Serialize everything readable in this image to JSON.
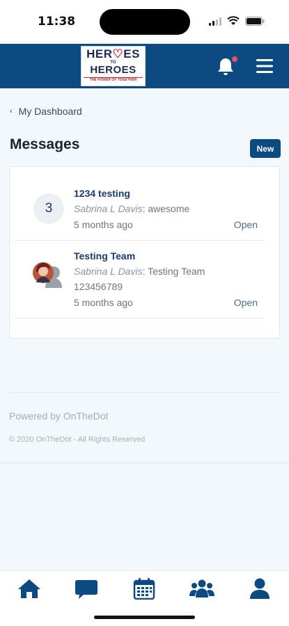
{
  "status_bar": {
    "time": "11:38"
  },
  "header": {
    "logo": {
      "line1": "HER",
      "line1_heart": "♡",
      "line1_end": "ES",
      "line2": "TO",
      "line3": "HEROES",
      "tagline": "THE POWER OF TOGETHER"
    }
  },
  "breadcrumb": {
    "chevron": "‹",
    "label": "My Dashboard"
  },
  "page": {
    "title": "Messages",
    "new_button": "New"
  },
  "threads": [
    {
      "badge": "3",
      "title": "1234 testing",
      "sender": "Sabrina L Davis",
      "preview": ": awesome",
      "extra": "",
      "time": "5 months ago",
      "action": "Open"
    },
    {
      "badge": "",
      "title": "Testing Team",
      "sender": "Sabrina L Davis",
      "preview": ": Testing Team",
      "extra": "123456789",
      "time": "5 months ago",
      "action": "Open"
    }
  ],
  "footer": {
    "powered": "Powered by OnTheDot",
    "copyright": "© 2020 OnTheDot - All Rights Reserved"
  },
  "tabbar": {
    "items": [
      "home-icon",
      "chat-icon",
      "calendar-icon",
      "group-icon",
      "profile-icon"
    ]
  },
  "colors": {
    "brand": "#0e4a82",
    "notification": "#e2565d",
    "link": "#173a72"
  }
}
